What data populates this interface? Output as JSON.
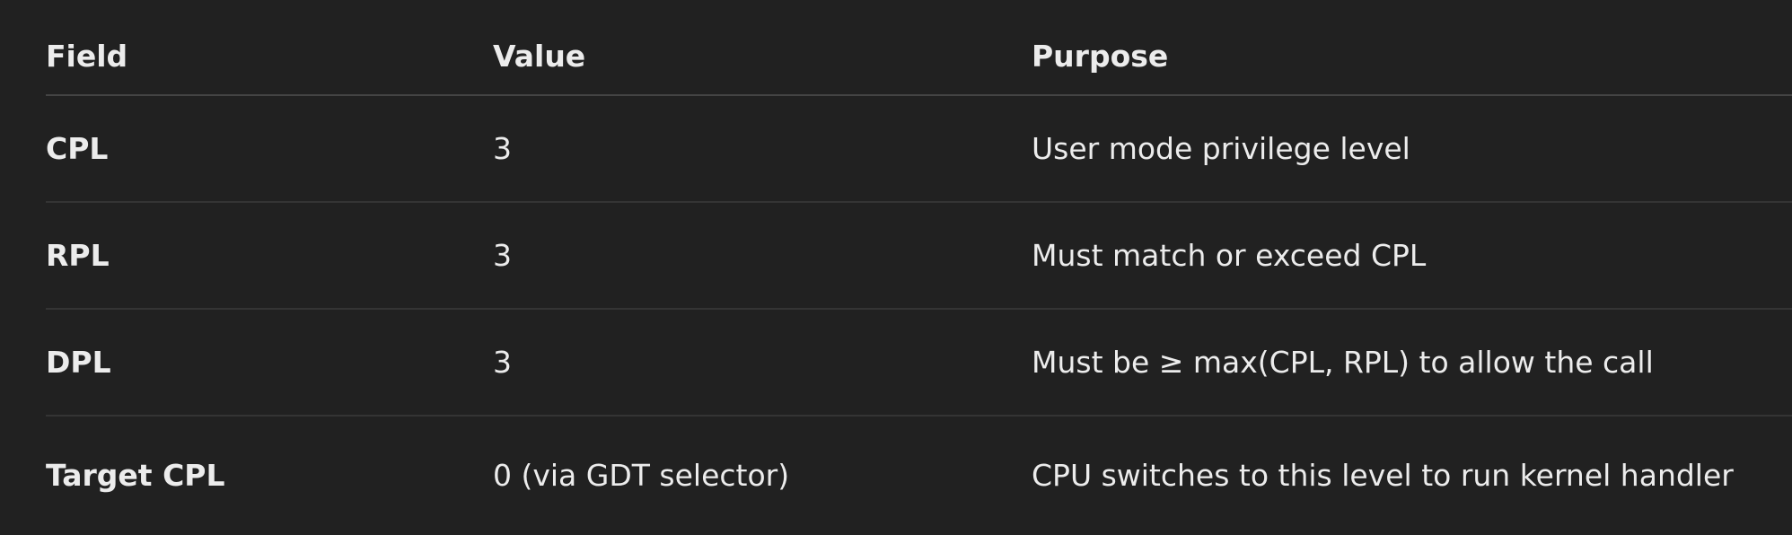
{
  "table": {
    "headers": [
      "Field",
      "Value",
      "Purpose"
    ],
    "rows": [
      {
        "field": "CPL",
        "value": "3",
        "purpose": "User mode privilege level"
      },
      {
        "field": "RPL",
        "value": "3",
        "purpose": "Must match or exceed CPL"
      },
      {
        "field": "DPL",
        "value": "3",
        "purpose": "Must be ≥ max(CPL, RPL) to allow the call"
      },
      {
        "field": "Target CPL",
        "value": "0 (via GDT selector)",
        "purpose": "CPU switches to this level to run kernel handler"
      }
    ]
  }
}
